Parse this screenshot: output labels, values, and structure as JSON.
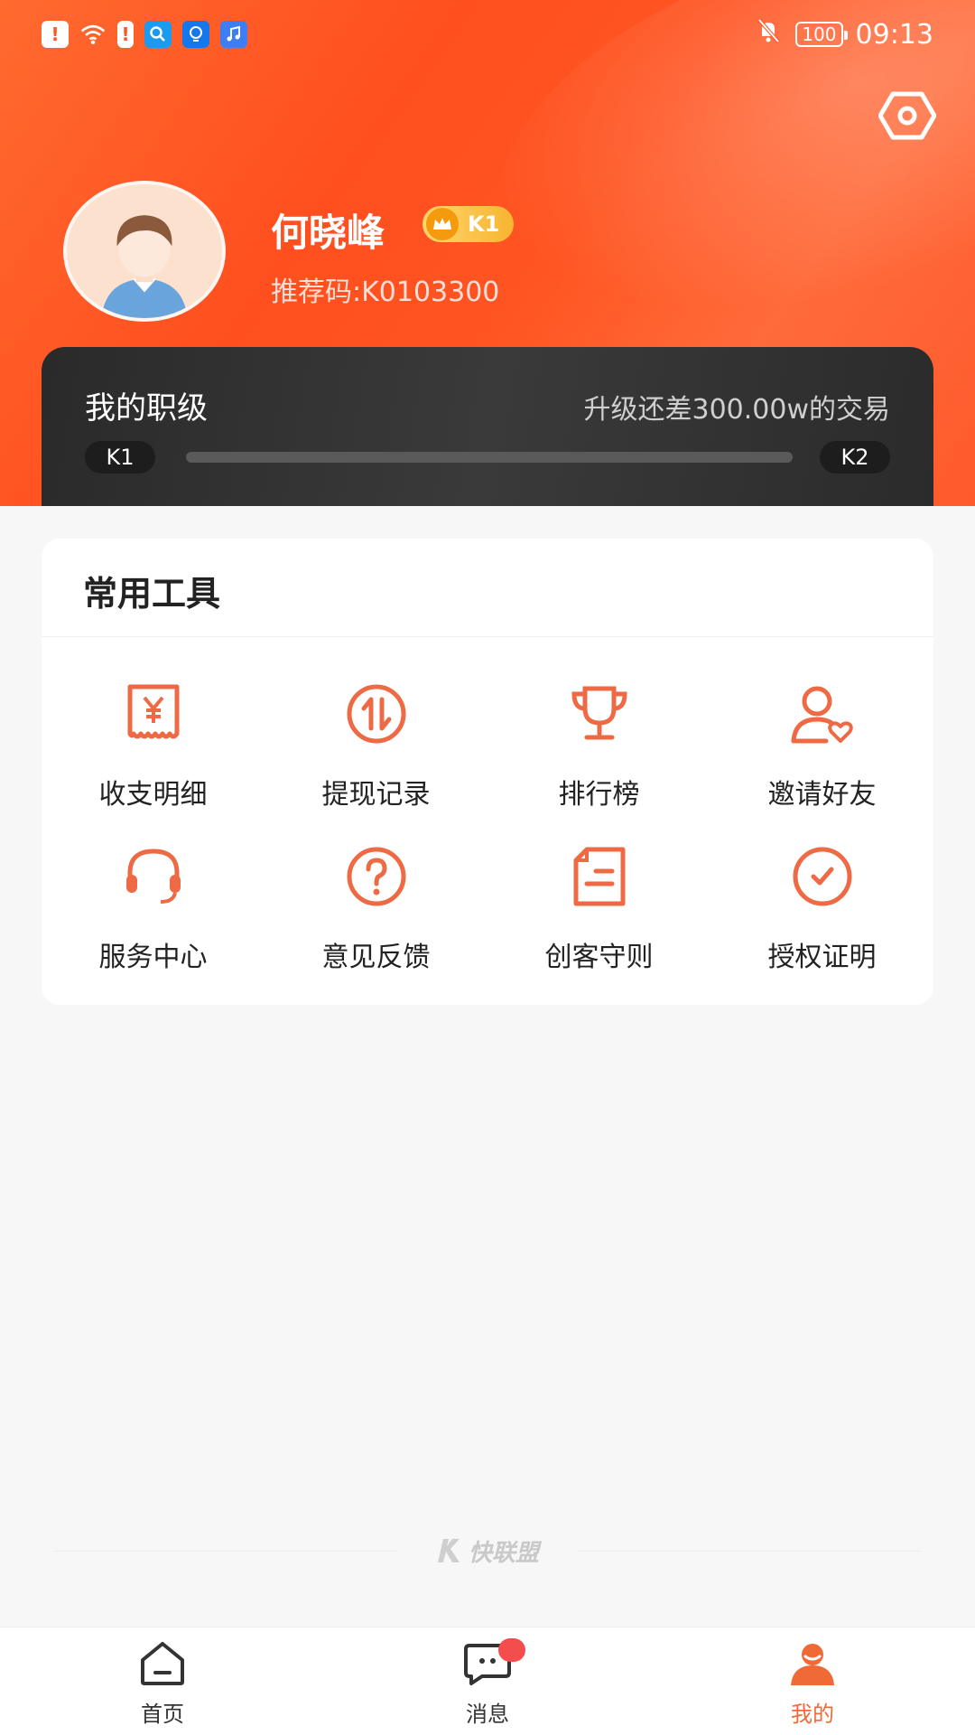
{
  "status_bar": {
    "time": "09:13",
    "battery": "100",
    "icons": [
      "alert-icon",
      "wifi-icon",
      "battery-warning-icon",
      "search-app-icon",
      "bulb-app-icon",
      "music-app-icon",
      "bell-off-icon"
    ]
  },
  "profile": {
    "name": "何晓峰",
    "level": "K1",
    "referral": "推荐码:K0103300"
  },
  "rank": {
    "title": "我的职级",
    "hint": "升级还差300.00w的交易",
    "current": "K1",
    "next": "K2",
    "progress": 0
  },
  "tools": {
    "title": "常用工具",
    "items": [
      {
        "label": "收支明细",
        "icon": "receipt-yen-icon"
      },
      {
        "label": "提现记录",
        "icon": "transfer-icon"
      },
      {
        "label": "排行榜",
        "icon": "trophy-icon"
      },
      {
        "label": "邀请好友",
        "icon": "user-heart-icon"
      },
      {
        "label": "服务中心",
        "icon": "headset-icon"
      },
      {
        "label": "意见反馈",
        "icon": "question-icon"
      },
      {
        "label": "创客守则",
        "icon": "document-icon"
      },
      {
        "label": "授权证明",
        "icon": "check-circle-icon"
      }
    ]
  },
  "footer": {
    "brand": "快联盟"
  },
  "nav": {
    "items": [
      {
        "label": "首页",
        "icon": "home-icon"
      },
      {
        "label": "消息",
        "icon": "message-icon"
      },
      {
        "label": "我的",
        "icon": "profile-icon"
      }
    ],
    "active": 2
  },
  "colors": {
    "accent": "#f06a38",
    "header": "#ff5522",
    "card_dark": "#2f2f2f"
  }
}
